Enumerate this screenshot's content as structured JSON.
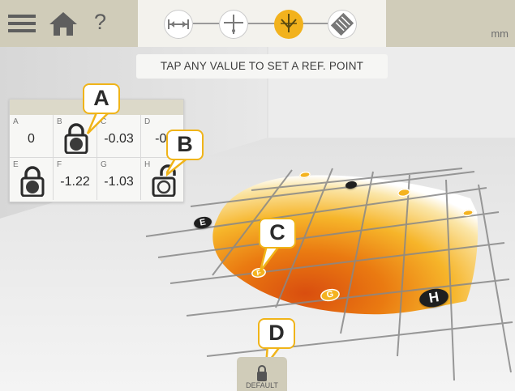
{
  "topbar": {
    "unit": "mm",
    "icons": [
      "menu-icon",
      "home-icon",
      "help-icon"
    ],
    "steps": [
      {
        "name": "distance-icon",
        "active": false
      },
      {
        "name": "crosshair-icon",
        "active": false
      },
      {
        "name": "flatness-icon",
        "active": true
      },
      {
        "name": "report-icon",
        "active": false
      }
    ],
    "help_mark": "?"
  },
  "hint": "TAP ANY VALUE TO SET A REF. POINT",
  "table": {
    "cells": [
      {
        "label": "A",
        "value": "0",
        "lock": "none"
      },
      {
        "label": "B",
        "value": "",
        "lock": "closed"
      },
      {
        "label": "C",
        "value": "-0.03",
        "lock": "none"
      },
      {
        "label": "D",
        "value": "-0.",
        "lock": "none"
      },
      {
        "label": "E",
        "value": "",
        "lock": "closed"
      },
      {
        "label": "F",
        "value": "-1.22",
        "lock": "none"
      },
      {
        "label": "G",
        "value": "-1.03",
        "lock": "none"
      },
      {
        "label": "H",
        "value": "",
        "lock": "open"
      }
    ]
  },
  "points": [
    {
      "label": "E",
      "style": "dark"
    },
    {
      "label": "",
      "style": "dark"
    },
    {
      "label": "",
      "style": "gold"
    },
    {
      "label": "",
      "style": "gold"
    },
    {
      "label": "",
      "style": "gold"
    },
    {
      "label": "F",
      "style": "gold"
    },
    {
      "label": "G",
      "style": "gold"
    },
    {
      "label": "H",
      "style": "dark"
    }
  ],
  "callouts": [
    "A",
    "B",
    "C",
    "D"
  ],
  "default_button": "DEFAULT",
  "colors": {
    "accent": "#f0b419",
    "bar": "#d0ccb9"
  }
}
